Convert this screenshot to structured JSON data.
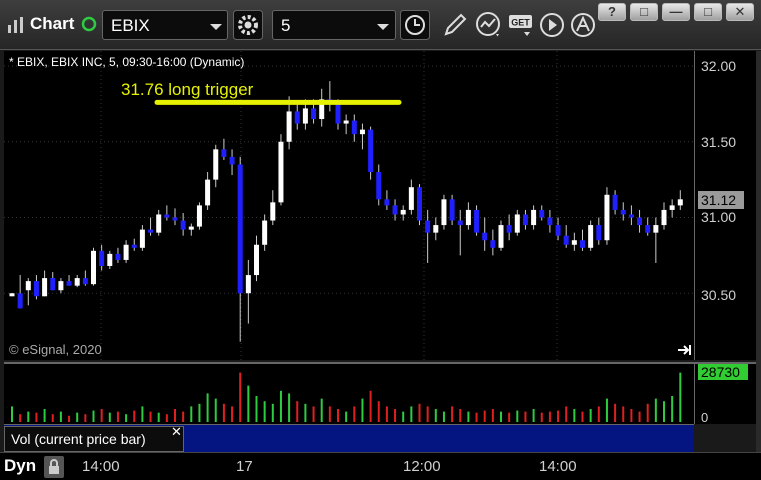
{
  "window": {
    "app_label": "Chart",
    "symbol": "EBIX",
    "interval": "5",
    "win_buttons": [
      "?",
      "□",
      "—",
      "□",
      "✕"
    ]
  },
  "toolbar_icons": [
    "gear-icon",
    "clock-icon",
    "pencil-icon",
    "indicator-icon",
    "get-icon",
    "play-icon",
    "alert-icon"
  ],
  "chart": {
    "title": "* EBIX, EBIX INC, 5, 09:30-16:00 (Dynamic)",
    "copyright": "© eSignal, 2020",
    "annotation": "31.76 long trigger",
    "current_price": "31.12",
    "y_ticks": [
      "32.00",
      "31.50",
      "31.00",
      "30.50"
    ],
    "colors": {
      "up": "#ffffff",
      "down": "#2020ff",
      "annotation": "#e6f200",
      "price_tag": "#9a9a9a",
      "volume_tag": "#32cd32"
    }
  },
  "volume": {
    "label": "Vol (current price bar)",
    "current": "28730",
    "zero_label": "0"
  },
  "x_axis": {
    "labels": [
      "14:00",
      "17",
      "12:00",
      "14:00"
    ],
    "mode": "Dyn"
  },
  "chart_data": {
    "type": "candlestick",
    "annotation_level": 31.76,
    "y_ticks": [
      32.0,
      31.5,
      31.0,
      30.5
    ],
    "ylim": [
      30.0,
      32.05
    ],
    "candles": [
      [
        30.48,
        30.5,
        30.48,
        30.5
      ],
      [
        30.5,
        30.62,
        30.4,
        30.4
      ],
      [
        30.52,
        30.6,
        30.42,
        30.58
      ],
      [
        30.58,
        30.62,
        30.46,
        30.48
      ],
      [
        30.48,
        30.65,
        30.48,
        30.6
      ],
      [
        30.6,
        30.64,
        30.52,
        30.52
      ],
      [
        30.52,
        30.6,
        30.5,
        30.58
      ],
      [
        30.58,
        30.62,
        30.55,
        30.55
      ],
      [
        30.55,
        30.62,
        30.54,
        30.6
      ],
      [
        30.6,
        30.65,
        30.55,
        30.56
      ],
      [
        30.56,
        30.8,
        30.55,
        30.78
      ],
      [
        30.78,
        30.82,
        30.65,
        30.68
      ],
      [
        30.68,
        30.78,
        30.66,
        30.76
      ],
      [
        30.76,
        30.8,
        30.7,
        30.72
      ],
      [
        30.72,
        30.85,
        30.7,
        30.82
      ],
      [
        30.82,
        30.86,
        30.78,
        30.8
      ],
      [
        30.8,
        30.95,
        30.78,
        30.92
      ],
      [
        30.92,
        31.0,
        30.88,
        30.9
      ],
      [
        30.9,
        31.05,
        30.88,
        31.02
      ],
      [
        31.02,
        31.08,
        30.98,
        31.0
      ],
      [
        31.0,
        31.06,
        30.95,
        30.98
      ],
      [
        30.98,
        31.03,
        30.88,
        30.92
      ],
      [
        30.92,
        30.96,
        30.88,
        30.94
      ],
      [
        30.94,
        31.1,
        30.92,
        31.08
      ],
      [
        31.08,
        31.3,
        31.05,
        31.25
      ],
      [
        31.25,
        31.48,
        31.2,
        31.45
      ],
      [
        31.45,
        31.52,
        31.38,
        31.4
      ],
      [
        31.4,
        31.45,
        31.28,
        31.35
      ],
      [
        31.35,
        31.4,
        30.18,
        30.5
      ],
      [
        30.5,
        30.72,
        30.3,
        30.62
      ],
      [
        30.62,
        30.88,
        30.58,
        30.82
      ],
      [
        30.82,
        31.02,
        30.78,
        30.98
      ],
      [
        30.98,
        31.18,
        30.95,
        31.1
      ],
      [
        31.1,
        31.55,
        31.08,
        31.5
      ],
      [
        31.5,
        31.8,
        31.45,
        31.7
      ],
      [
        31.7,
        31.75,
        31.58,
        31.62
      ],
      [
        31.62,
        31.78,
        31.58,
        31.72
      ],
      [
        31.72,
        31.78,
        31.62,
        31.65
      ],
      [
        31.65,
        31.85,
        31.6,
        31.78
      ],
      [
        31.78,
        31.9,
        31.7,
        31.75
      ],
      [
        31.75,
        31.78,
        31.58,
        31.62
      ],
      [
        31.62,
        31.68,
        31.55,
        31.64
      ],
      [
        31.64,
        31.68,
        31.5,
        31.55
      ],
      [
        31.55,
        31.62,
        31.45,
        31.58
      ],
      [
        31.58,
        31.6,
        31.25,
        31.3
      ],
      [
        31.3,
        31.35,
        31.08,
        31.12
      ],
      [
        31.12,
        31.18,
        31.05,
        31.08
      ],
      [
        31.08,
        31.12,
        30.98,
        31.02
      ],
      [
        31.02,
        31.08,
        30.98,
        31.05
      ],
      [
        31.05,
        31.25,
        31.02,
        31.2
      ],
      [
        31.2,
        31.22,
        30.95,
        30.98
      ],
      [
        30.98,
        31.05,
        30.7,
        30.9
      ],
      [
        30.9,
        31.0,
        30.85,
        30.95
      ],
      [
        30.95,
        31.15,
        30.92,
        31.12
      ],
      [
        31.12,
        31.15,
        30.95,
        30.98
      ],
      [
        30.98,
        31.05,
        30.75,
        30.95
      ],
      [
        30.95,
        31.1,
        30.92,
        31.05
      ],
      [
        31.05,
        31.08,
        30.88,
        30.9
      ],
      [
        30.9,
        31.0,
        30.78,
        30.85
      ],
      [
        30.85,
        30.92,
        30.75,
        30.8
      ],
      [
        30.8,
        30.98,
        30.78,
        30.95
      ],
      [
        30.95,
        31.02,
        30.85,
        30.9
      ],
      [
        30.9,
        31.05,
        30.88,
        31.02
      ],
      [
        31.02,
        31.05,
        30.92,
        30.95
      ],
      [
        30.95,
        31.08,
        30.92,
        31.05
      ],
      [
        31.05,
        31.08,
        30.98,
        31.0
      ],
      [
        31.0,
        31.05,
        30.9,
        30.95
      ],
      [
        30.95,
        31.0,
        30.85,
        30.88
      ],
      [
        30.88,
        30.95,
        30.8,
        30.82
      ],
      [
        30.82,
        30.9,
        30.78,
        30.85
      ],
      [
        30.85,
        30.92,
        30.78,
        30.8
      ],
      [
        30.8,
        30.98,
        30.78,
        30.95
      ],
      [
        30.95,
        31.0,
        30.82,
        30.85
      ],
      [
        30.85,
        31.2,
        30.82,
        31.15
      ],
      [
        31.15,
        31.18,
        31.02,
        31.05
      ],
      [
        31.05,
        31.1,
        30.98,
        31.02
      ],
      [
        31.02,
        31.08,
        30.95,
        31.0
      ],
      [
        31.0,
        31.05,
        30.9,
        30.95
      ],
      [
        30.95,
        31.0,
        30.88,
        30.9
      ],
      [
        30.9,
        31.0,
        30.7,
        30.95
      ],
      [
        30.95,
        31.1,
        30.92,
        31.05
      ],
      [
        31.05,
        31.12,
        31.0,
        31.08
      ],
      [
        31.08,
        31.18,
        31.05,
        31.12
      ]
    ],
    "volume": [
      0.3,
      0.15,
      0.2,
      0.18,
      0.25,
      0.15,
      0.2,
      0.12,
      0.18,
      0.15,
      0.22,
      0.25,
      0.18,
      0.2,
      0.15,
      0.22,
      0.3,
      0.2,
      0.18,
      0.15,
      0.25,
      0.2,
      0.3,
      0.35,
      0.55,
      0.45,
      0.35,
      0.3,
      0.95,
      0.7,
      0.5,
      0.4,
      0.35,
      0.6,
      0.55,
      0.4,
      0.35,
      0.3,
      0.45,
      0.3,
      0.25,
      0.2,
      0.3,
      0.45,
      0.6,
      0.4,
      0.3,
      0.25,
      0.2,
      0.3,
      0.35,
      0.3,
      0.25,
      0.2,
      0.3,
      0.25,
      0.2,
      0.18,
      0.22,
      0.25,
      0.2,
      0.18,
      0.22,
      0.2,
      0.25,
      0.18,
      0.2,
      0.22,
      0.3,
      0.25,
      0.2,
      0.25,
      0.3,
      0.45,
      0.35,
      0.3,
      0.25,
      0.2,
      0.35,
      0.45,
      0.4,
      0.5,
      0.95
    ]
  }
}
